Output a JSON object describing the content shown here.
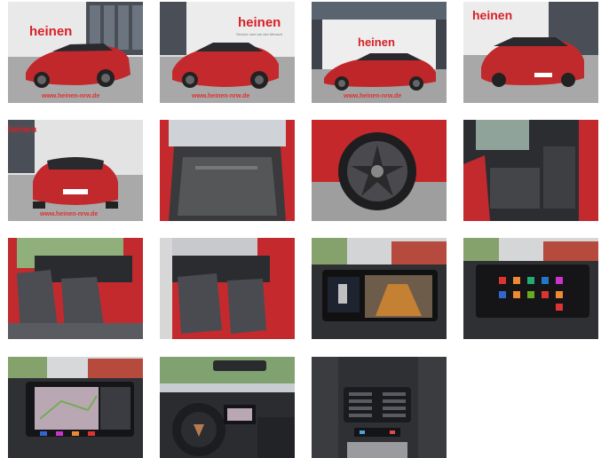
{
  "gallery": {
    "watermark": "www.heinen-nrw.de",
    "dealer_logo": "heinen",
    "dealer_tagline": "Service rund um den Mensch",
    "photos": [
      {
        "name": "front-left-exterior"
      },
      {
        "name": "front-right-exterior"
      },
      {
        "name": "side-profile-exterior"
      },
      {
        "name": "rear-left-exterior"
      },
      {
        "name": "rear-exterior"
      },
      {
        "name": "trunk-interior"
      },
      {
        "name": "wheel-closeup"
      },
      {
        "name": "rear-seats"
      },
      {
        "name": "front-seats-passenger-view"
      },
      {
        "name": "front-seats-driver-view"
      },
      {
        "name": "parking-camera-display"
      },
      {
        "name": "infotainment-apps-menu"
      },
      {
        "name": "infotainment-navigation"
      },
      {
        "name": "dashboard-steering-wheel"
      },
      {
        "name": "rear-air-vents"
      }
    ]
  }
}
